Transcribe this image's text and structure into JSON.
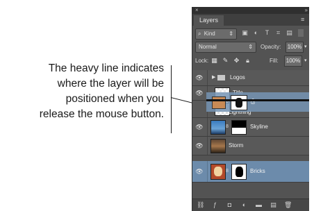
{
  "callout": {
    "lines": [
      "The heavy line indicates",
      "where the layer will be",
      "positioned when you",
      "release the mouse button."
    ]
  },
  "panel": {
    "tab_label": "Layers",
    "filter": {
      "kind_label": "Kind",
      "icons": [
        "pixel-filter-icon",
        "adjustment-filter-icon",
        "type-filter-icon",
        "shape-filter-icon",
        "smart-object-filter-icon"
      ]
    },
    "blend_mode": "Normal",
    "opacity_label": "Opacity:",
    "opacity_value": "100%",
    "lock_label": "Lock:",
    "fill_label": "Fill:",
    "fill_value": "100%",
    "layers": [
      {
        "name": "Logos",
        "type": "group"
      },
      {
        "name": "Title",
        "type": "layer"
      },
      {
        "name": "Lightning",
        "type": "layer-mask"
      },
      {
        "name": "Skyline",
        "type": "layer-mask"
      },
      {
        "name": "Storm",
        "type": "layer"
      },
      {
        "name": "Bricks",
        "type": "layer-mask",
        "selected": true
      }
    ],
    "dragging_layer": "Lightning"
  },
  "colors": {
    "panel_bg": "#535353",
    "selected_row": "#6c8bab",
    "drop_line": "#101010"
  }
}
